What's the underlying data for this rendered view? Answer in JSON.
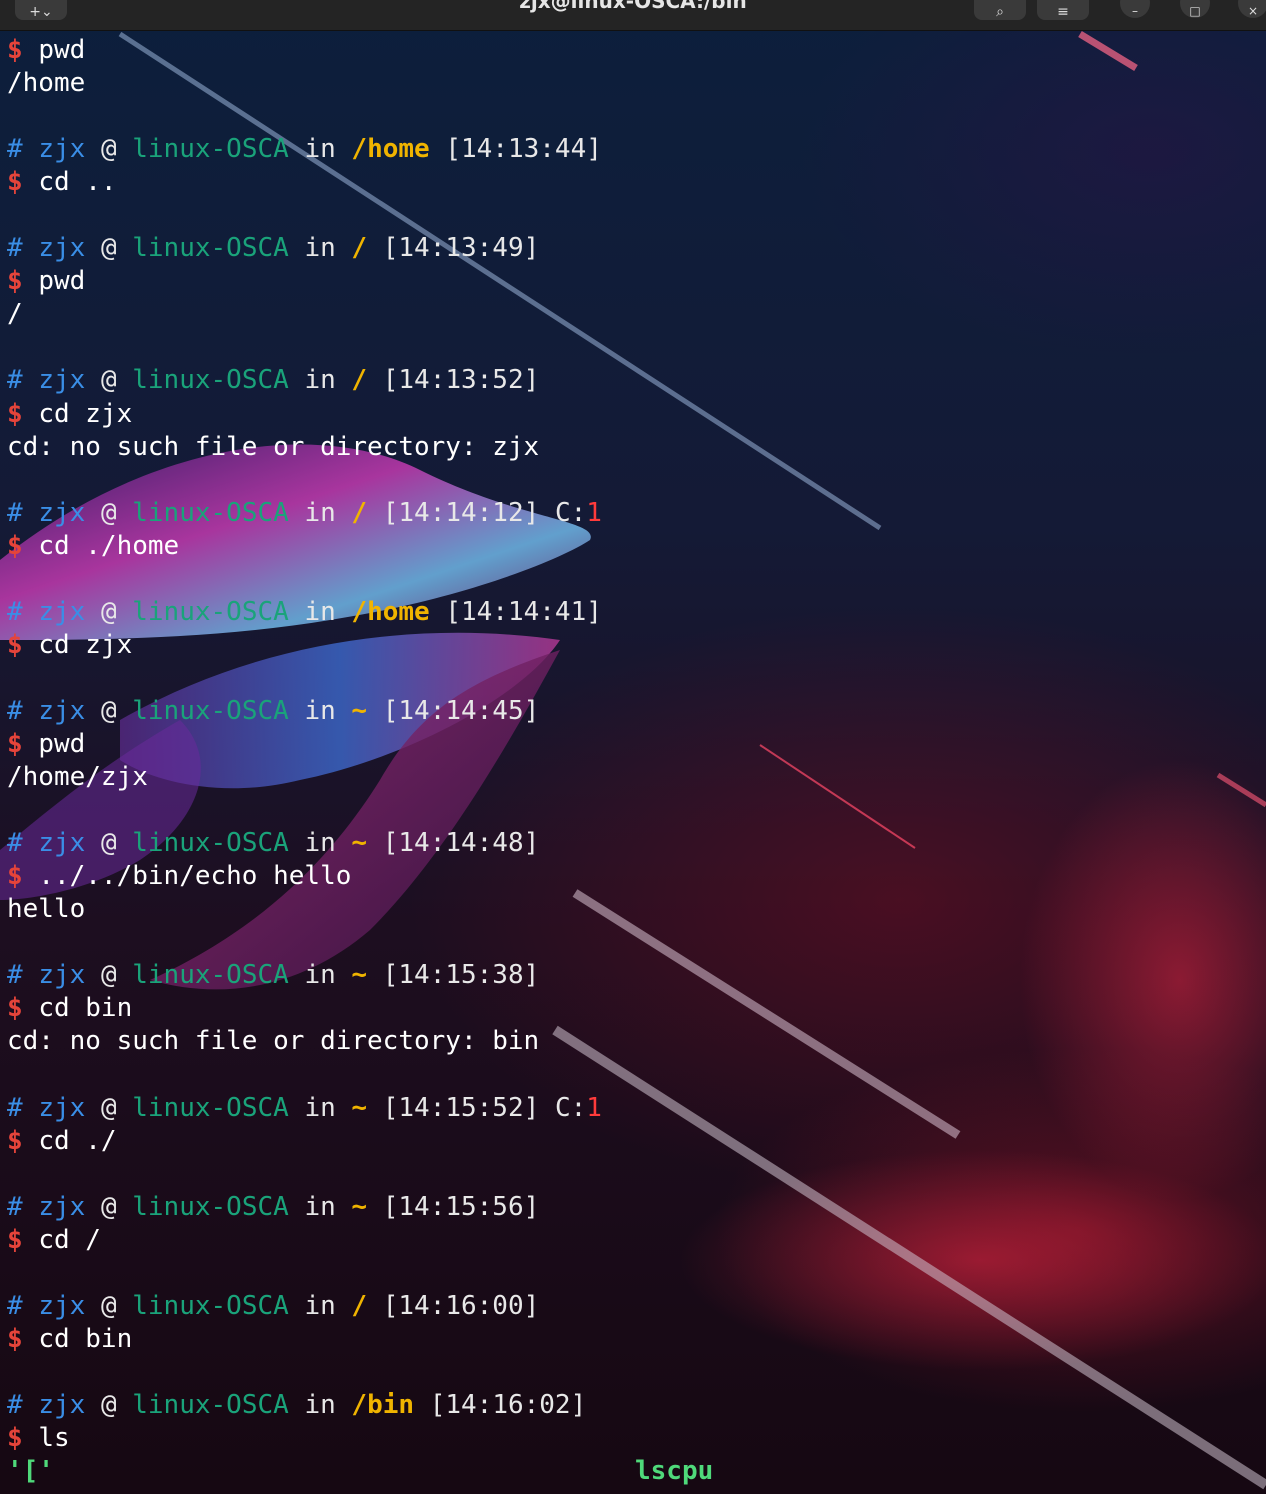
{
  "window": {
    "title": "zjx@linux-OSCA:/bin",
    "buttons": [
      "new-tab",
      "search",
      "menu",
      "minimize",
      "maximize",
      "close"
    ]
  },
  "terminal": {
    "colors": {
      "hash": "#3a8ee6",
      "host": "#1aa37a",
      "dir": "#f0b400",
      "dollar": "#e5443a",
      "exit_code": "#ff3b3b",
      "exec": "#4fd97a"
    },
    "prompt": {
      "hash": "#",
      "user": "zjx",
      "at": "@",
      "host": "linux-OSCA",
      "in": "in",
      "dollar": "$",
      "exit_prefix": "C:"
    },
    "lines": [
      {
        "type": "cmd",
        "text": "pwd"
      },
      {
        "type": "out",
        "text": "/home"
      },
      {
        "type": "blank"
      },
      {
        "type": "prompt",
        "dir": "/home",
        "time": "[14:13:44]"
      },
      {
        "type": "cmd",
        "text": "cd .."
      },
      {
        "type": "blank"
      },
      {
        "type": "prompt",
        "dir": "/",
        "time": "[14:13:49]"
      },
      {
        "type": "cmd",
        "text": "pwd"
      },
      {
        "type": "out",
        "text": "/"
      },
      {
        "type": "blank"
      },
      {
        "type": "prompt",
        "dir": "/",
        "time": "[14:13:52]"
      },
      {
        "type": "cmd",
        "text": "cd zjx"
      },
      {
        "type": "out",
        "text": "cd: no such file or directory: zjx"
      },
      {
        "type": "blank"
      },
      {
        "type": "prompt",
        "dir": "/",
        "time": "[14:14:12]",
        "exit": "1"
      },
      {
        "type": "cmd",
        "text": "cd ./home"
      },
      {
        "type": "blank"
      },
      {
        "type": "prompt",
        "dir": "/home",
        "time": "[14:14:41]"
      },
      {
        "type": "cmd",
        "text": "cd zjx"
      },
      {
        "type": "blank"
      },
      {
        "type": "prompt",
        "dir": "~",
        "time": "[14:14:45]"
      },
      {
        "type": "cmd",
        "text": "pwd"
      },
      {
        "type": "out",
        "text": "/home/zjx"
      },
      {
        "type": "blank"
      },
      {
        "type": "prompt",
        "dir": "~",
        "time": "[14:14:48]"
      },
      {
        "type": "cmd",
        "text": "../../bin/echo hello"
      },
      {
        "type": "out",
        "text": "hello"
      },
      {
        "type": "blank"
      },
      {
        "type": "prompt",
        "dir": "~",
        "time": "[14:15:38]"
      },
      {
        "type": "cmd",
        "text": "cd bin"
      },
      {
        "type": "out",
        "text": "cd: no such file or directory: bin"
      },
      {
        "type": "blank"
      },
      {
        "type": "prompt",
        "dir": "~",
        "time": "[14:15:52]",
        "exit": "1"
      },
      {
        "type": "cmd",
        "text": "cd ./"
      },
      {
        "type": "blank"
      },
      {
        "type": "prompt",
        "dir": "~",
        "time": "[14:15:56]"
      },
      {
        "type": "cmd",
        "text": "cd /"
      },
      {
        "type": "blank"
      },
      {
        "type": "prompt",
        "dir": "/",
        "time": "[14:16:00]"
      },
      {
        "type": "cmd",
        "text": "cd bin"
      },
      {
        "type": "blank"
      },
      {
        "type": "prompt",
        "dir": "/bin",
        "time": "[14:16:02]"
      },
      {
        "type": "cmd",
        "text": "ls"
      },
      {
        "type": "ls",
        "cols": [
          "'['",
          "lscpu"
        ]
      }
    ]
  }
}
